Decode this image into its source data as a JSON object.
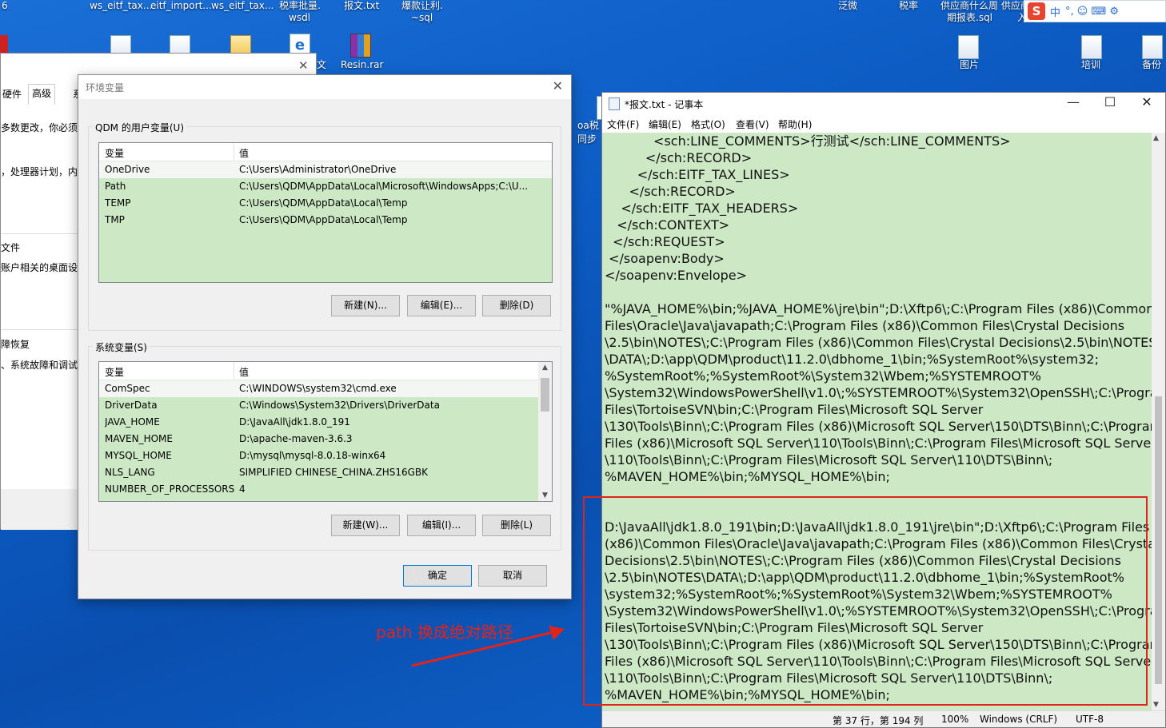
{
  "desktop": {
    "top_labels": [
      "6",
      "ws_eitf_tax...",
      "eitf_import...",
      "ws_eitf_tax...",
      "税率批量.",
      "wsdl",
      "报文.txt",
      "爆款让利.",
      "~sql",
      "泛微",
      "税率",
      "供应商什么周 供应商",
      "期报表.sql",
      "入账"
    ],
    "mid_labels": [
      "文",
      "Resin.rar",
      "oa税",
      "同步"
    ],
    "right_labels": [
      "图片",
      "培训",
      "备份"
    ]
  },
  "ime": {
    "s_icon": "S",
    "zh": "中",
    "items": "°, ☺ ⌨ ⚙"
  },
  "system_properties": {
    "tabs": [
      "硬件",
      "高级",
      "系"
    ],
    "lines": [
      "多数更改，你必须作",
      "，处理器计划，内",
      "文件",
      "账户相关的桌面设置",
      "障恢复",
      "、系统故障和调试"
    ]
  },
  "env_dialog": {
    "title": "环境变量",
    "user_group_title": "QDM 的用户变量(U)",
    "col_var": "变量",
    "col_val": "值",
    "user_vars": [
      {
        "name": "OneDrive",
        "value": "C:\\Users\\Administrator\\OneDrive"
      },
      {
        "name": "Path",
        "value": "C:\\Users\\QDM\\AppData\\Local\\Microsoft\\WindowsApps;C:\\U..."
      },
      {
        "name": "TEMP",
        "value": "C:\\Users\\QDM\\AppData\\Local\\Temp"
      },
      {
        "name": "TMP",
        "value": "C:\\Users\\QDM\\AppData\\Local\\Temp"
      }
    ],
    "user_buttons": {
      "new": "新建(N)...",
      "edit": "编辑(E)...",
      "delete": "删除(D)"
    },
    "sys_group_title": "系统变量(S)",
    "sys_vars": [
      {
        "name": "ComSpec",
        "value": "C:\\WINDOWS\\system32\\cmd.exe"
      },
      {
        "name": "DriverData",
        "value": "C:\\Windows\\System32\\Drivers\\DriverData"
      },
      {
        "name": "JAVA_HOME",
        "value": "D:\\JavaAll\\jdk1.8.0_191"
      },
      {
        "name": "MAVEN_HOME",
        "value": "D:\\apache-maven-3.6.3"
      },
      {
        "name": "MYSQL_HOME",
        "value": "D:\\mysql\\mysql-8.0.18-winx64"
      },
      {
        "name": "NLS_LANG",
        "value": "SIMPLIFIED CHINESE_CHINA.ZHS16GBK"
      },
      {
        "name": "NUMBER_OF_PROCESSORS",
        "value": "4"
      }
    ],
    "sys_buttons": {
      "new": "新建(W)...",
      "edit": "编辑(I)...",
      "delete": "删除(L)"
    },
    "ok": "确定",
    "cancel": "取消"
  },
  "notepad": {
    "title": "*报文.txt - 记事本",
    "menu": [
      "文件(F)",
      "编辑(E)",
      "格式(O)",
      "查看(V)",
      "帮助(H)"
    ],
    "content": "            <sch:LINE_COMMENTS>行测试</sch:LINE_COMMENTS>\n          </sch:RECORD>\n        </sch:EITF_TAX_LINES>\n      </sch:RECORD>\n    </sch:EITF_TAX_HEADERS>\n   </sch:CONTEXT>\n  </sch:REQUEST>\n </soapenv:Body>\n</soapenv:Envelope>\n\n\"%JAVA_HOME%\\bin;%JAVA_HOME%\\jre\\bin\";D:\\Xftp6\\;C:\\Program Files (x86)\\Common\nFiles\\Oracle\\Java\\javapath;C:\\Program Files (x86)\\Common Files\\Crystal Decisions\n\\2.5\\bin\\NOTES\\;C:\\Program Files (x86)\\Common Files\\Crystal Decisions\\2.5\\bin\\NOTES\n\\DATA\\;D:\\app\\QDM\\product\\11.2.0\\dbhome_1\\bin;%SystemRoot%\\system32;\n%SystemRoot%;%SystemRoot%\\System32\\Wbem;%SYSTEMROOT%\n\\System32\\WindowsPowerShell\\v1.0\\;%SYSTEMROOT%\\System32\\OpenSSH\\;C:\\Program\nFiles\\TortoiseSVN\\bin;C:\\Program Files\\Microsoft SQL Server\n\\130\\Tools\\Binn\\;C:\\Program Files (x86)\\Microsoft SQL Server\\150\\DTS\\Binn\\;C:\\Program\nFiles (x86)\\Microsoft SQL Server\\110\\Tools\\Binn\\;C:\\Program Files\\Microsoft SQL Server\n\\110\\Tools\\Binn\\;C:\\Program Files\\Microsoft SQL Server\\110\\DTS\\Binn\\;\n%MAVEN_HOME%\\bin;%MYSQL_HOME%\\bin;\n\n\nD:\\JavaAll\\jdk1.8.0_191\\bin;D:\\JavaAll\\jdk1.8.0_191\\jre\\bin\";D:\\Xftp6\\;C:\\Program Files\n(x86)\\Common Files\\Oracle\\Java\\javapath;C:\\Program Files (x86)\\Common Files\\Crystal\nDecisions\\2.5\\bin\\NOTES\\;C:\\Program Files (x86)\\Common Files\\Crystal Decisions\n\\2.5\\bin\\NOTES\\DATA\\;D:\\app\\QDM\\product\\11.2.0\\dbhome_1\\bin;%SystemRoot%\n\\system32;%SystemRoot%;%SystemRoot%\\System32\\Wbem;%SYSTEMROOT%\n\\System32\\WindowsPowerShell\\v1.0\\;%SYSTEMROOT%\\System32\\OpenSSH\\;C:\\Program\nFiles\\TortoiseSVN\\bin;C:\\Program Files\\Microsoft SQL Server\n\\130\\Tools\\Binn\\;C:\\Program Files (x86)\\Microsoft SQL Server\\150\\DTS\\Binn\\;C:\\Program\nFiles (x86)\\Microsoft SQL Server\\110\\Tools\\Binn\\;C:\\Program Files\\Microsoft SQL Server\n\\110\\Tools\\Binn\\;C:\\Program Files\\Microsoft SQL Server\\110\\DTS\\Binn\\;\n%MAVEN_HOME%\\bin;%MYSQL_HOME%\\bin;",
    "status": {
      "position": "第 37 行，第 194 列",
      "zoom": "100%",
      "eol": "Windows (CRLF)",
      "encoding": "UTF-8"
    }
  },
  "annotation": "path 换成绝对路径",
  "colors": {
    "highlight": "#cde8c4",
    "annotation_red": "#e0241c",
    "desktop_blue": "#0c5cc4"
  }
}
